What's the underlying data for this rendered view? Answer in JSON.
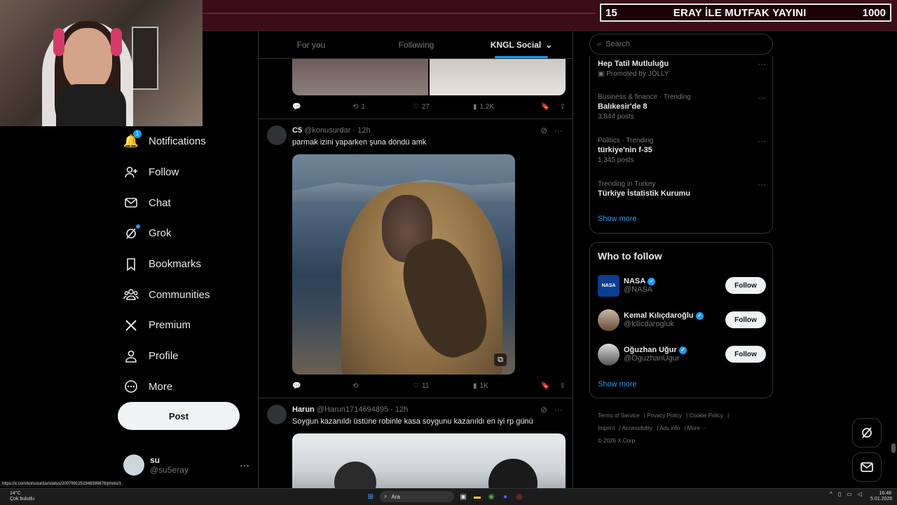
{
  "overlay": {
    "score_left": "15",
    "title": "ERAY İLE MUTFAK YAYINI",
    "score_right": "1000"
  },
  "nav": {
    "items": [
      {
        "label": "Notifications",
        "icon": "bell-icon",
        "badge": "1"
      },
      {
        "label": "Follow",
        "icon": "person-plus-icon"
      },
      {
        "label": "Chat",
        "icon": "mail-icon"
      },
      {
        "label": "Grok",
        "icon": "grok-icon"
      },
      {
        "label": "Bookmarks",
        "icon": "bookmark-icon"
      },
      {
        "label": "Communities",
        "icon": "communities-icon"
      },
      {
        "label": "Premium",
        "icon": "x-logo-icon"
      },
      {
        "label": "Profile",
        "icon": "person-icon"
      },
      {
        "label": "More",
        "icon": "more-circle-icon"
      }
    ],
    "post_label": "Post"
  },
  "account": {
    "name": "su",
    "handle": "@su5eray"
  },
  "tabs": [
    {
      "label": "For you"
    },
    {
      "label": "Following"
    },
    {
      "label": "KNGL Social"
    }
  ],
  "prev_tweet": {
    "replies": "",
    "reposts": "1",
    "likes": "27",
    "views": "1.2K"
  },
  "tweet1": {
    "name": "C5",
    "handle": "@konusurdar",
    "time": "· 12h",
    "text": "parmak izini yaparken şuna döndü amk",
    "replies": "",
    "reposts": "",
    "likes": "11",
    "views": "1K"
  },
  "tweet2": {
    "name": "Harun",
    "handle": "@Harun1714694895",
    "time": "· 12h",
    "text": "Soygun kazanıldı üstüne robinle kasa soygunu kazanıldı en iyi rp günü"
  },
  "search": {
    "placeholder": "Search"
  },
  "trends": [
    {
      "category": "",
      "title": "Hep Tatil Mutluluğu",
      "posts": "Promoted by JOLLY"
    },
    {
      "category": "Business & finance · Trending",
      "title": "Balıkesir'de 8",
      "posts": "3,844 posts"
    },
    {
      "category": "Politics · Trending",
      "title": "türkiye'nin f-35",
      "posts": "1,345 posts"
    },
    {
      "category": "Trending in Turkey",
      "title": "Türkiye İstatistik Kurumu",
      "posts": ""
    }
  ],
  "trends_show_more": "Show more",
  "who_to_follow": {
    "title": "Who to follow",
    "users": [
      {
        "name": "NASA",
        "handle": "@NASA",
        "button": "Follow"
      },
      {
        "name": "Kemal Kılıçdaroğlu",
        "handle": "@kilicdarogluk",
        "button": "Follow"
      },
      {
        "name": "Oğuzhan Uğur",
        "handle": "@OguzhanUgur",
        "button": "Follow"
      }
    ],
    "show_more": "Show more"
  },
  "footer": {
    "links": [
      "Terms of Service",
      "Privacy Policy",
      "Cookie Policy",
      "Imprint",
      "Accessibility",
      "Ads info",
      "More ···"
    ],
    "copyright": "© 2026 X Corp."
  },
  "taskbar": {
    "temp": "14°C",
    "weather": "Çok bulutlu",
    "search": "Ara",
    "time": "16:48",
    "date": "5.01.2026"
  },
  "status_url": "https://x.com/konusurdar/status/2007991251946389676/photo/1",
  "colors": {
    "accent": "#1d9bf0",
    "bg": "#000000",
    "border": "#2f3336",
    "muted": "#71767b"
  }
}
